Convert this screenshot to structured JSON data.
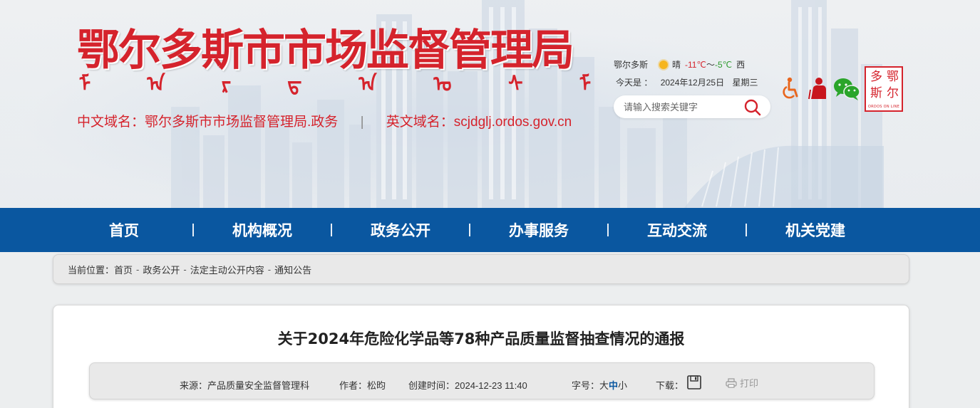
{
  "header": {
    "site_title": "鄂尔多斯市市场监督管理局",
    "mongolian_glyphs": [
      "ᠮ",
      "ᠠ",
      "ᠷ",
      "ᠳ",
      "ᠠ",
      "ᠤ",
      "ᠰ",
      "ᠮ"
    ],
    "domain_cn_label": "中文域名：鄂尔多斯市市场监督管理局.政务",
    "domain_separator": "|",
    "domain_en_label": "英文域名：scjdglj.ordos.gov.cn"
  },
  "weather": {
    "city": "鄂尔多斯",
    "icon": "sun-icon",
    "condition": "晴",
    "high": "-11℃",
    "tilde": "～",
    "low": "-5℃",
    "wind": "西"
  },
  "today": {
    "label": "今天是 ：",
    "date": "2024年12月25日",
    "weekday": "星期三"
  },
  "search": {
    "placeholder": "请输入搜索关键字"
  },
  "logo": {
    "chars": [
      "多",
      "鄂",
      "斯",
      "尔"
    ],
    "sub": "ORDOS ON LINE"
  },
  "nav": {
    "items": [
      "首页",
      "机构概况",
      "政务公开",
      "办事服务",
      "互动交流",
      "机关党建"
    ]
  },
  "breadcrumb": {
    "prefix": "当前位置：",
    "items": [
      "首页",
      "政务公开",
      "法定主动公开内容",
      "通知公告"
    ],
    "arrow": "-"
  },
  "article": {
    "title": "关于2024年危险化学品等78种产品质量监督抽查情况的通报",
    "source": "来源：产品质量安全监督管理科",
    "author": "作者：松昀",
    "created": "创建时间：2024-12-23 11:40",
    "font_size_label": "字号：",
    "font_sizes": [
      "大",
      "中",
      "小"
    ],
    "download_label": "下载：",
    "print_label": "打印"
  },
  "colors": {
    "brand_red": "#d5232c",
    "nav_blue": "#0a57a0",
    "temp_low_green": "#2d9a2d"
  }
}
